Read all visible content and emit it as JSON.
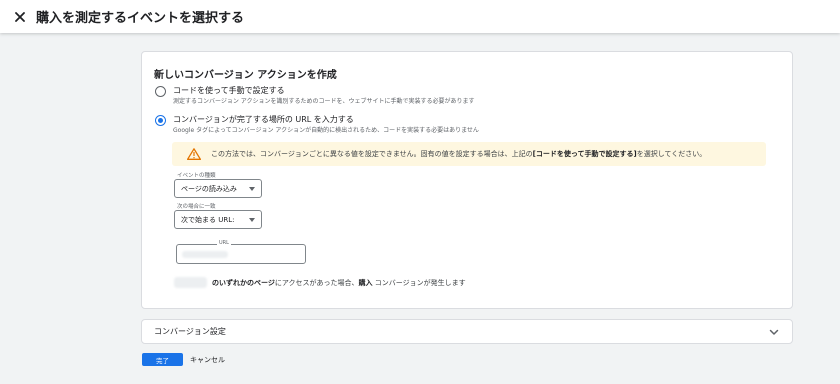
{
  "header": {
    "close_icon": "close-icon",
    "title": "購入を測定するイベントを選択する"
  },
  "card": {
    "title": "新しいコンバージョン アクションを作成",
    "option_manual": {
      "label": "コードを使って手動で設定する",
      "description": "測定するコンバージョン アクションを識別するためのコードを、ウェブサイトに手動で実装する必要があります",
      "selected": false
    },
    "option_url": {
      "label": "コンバージョンが完了する場所の URL を入力する",
      "description": "Google タグによってコンバージョン アクションが自動的に検出されるため、コードを実装する必要はありません",
      "selected": true
    },
    "warning": {
      "icon": "warning-icon",
      "color": "#fef7e0",
      "text_before": "この方法では、コンバージョンごとに異なる値を設定できません。固有の値を設定する場合は、上記の",
      "text_bold": "[コードを使って手動で設定する]",
      "text_after": "を選択してください。"
    },
    "event_type": {
      "label": "イベントの種類",
      "value": "ページの読み込み"
    },
    "match_type": {
      "label": "次の場合に一致",
      "value": "次で始まる URL:"
    },
    "url_field": {
      "label": "URL"
    },
    "result": {
      "bold1": "のいずれかのページ",
      "text1": "にアクセスがあった場合、",
      "bold2": "購入",
      "text2": " コンバージョンが発生します"
    }
  },
  "conversion_settings": {
    "title": "コンバージョン設定",
    "icon": "chevron-down-icon"
  },
  "actions": {
    "done_label": "完了",
    "cancel_label": "キャンセル",
    "primary_color": "#1a73e8"
  }
}
